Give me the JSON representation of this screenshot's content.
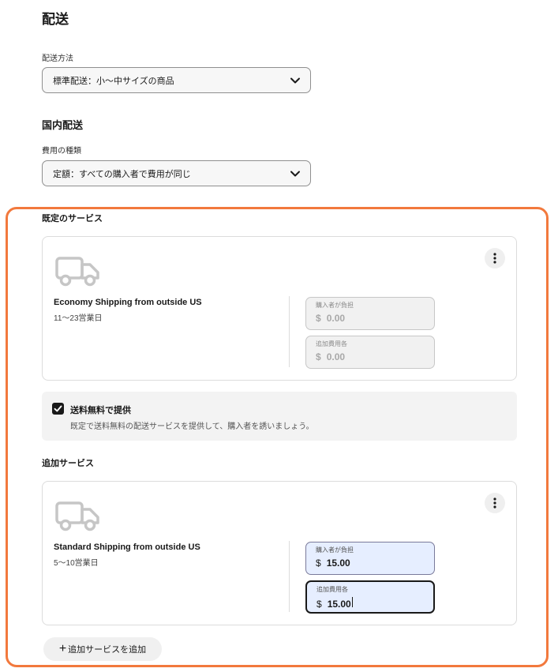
{
  "page": {
    "title": "配送"
  },
  "shipping_method": {
    "label": "配送方法",
    "value": "標準配送：小〜中サイズの商品"
  },
  "domestic": {
    "title": "国内配送",
    "cost_type_label": "費用の種類",
    "cost_type_value": "定額：すべての購入者で費用が同じ"
  },
  "default_services": {
    "title": "既定のサービス",
    "service": {
      "name": "Economy Shipping from outside US",
      "days": "11〜23営業日",
      "buyer_pays": {
        "label": "購入者が負担",
        "currency": "$",
        "value": "0.00"
      },
      "each_additional": {
        "label": "追加費用各",
        "currency": "$",
        "value": "0.00"
      }
    }
  },
  "free_shipping": {
    "checked": true,
    "label": "送料無料で提供",
    "description": "既定で送料無料の配送サービスを提供して、購入者を誘いましょう。"
  },
  "additional_services": {
    "title": "追加サービス",
    "service": {
      "name": "Standard Shipping from outside US",
      "days": "5〜10営業日",
      "buyer_pays": {
        "label": "購入者が負担",
        "currency": "$",
        "value": "15.00"
      },
      "each_additional": {
        "label": "追加費用各",
        "currency": "$",
        "value": "15.00"
      }
    },
    "add_button": {
      "plus": "+",
      "label": "追加サービスを追加"
    }
  },
  "icons": {
    "dropdown": "chevron-down-icon",
    "truck": "truck-icon",
    "more": "more-vertical-icon",
    "checkbox": "checkmark-icon"
  },
  "colors": {
    "highlight": "#f2793d",
    "focused_input_bg": "#e6eeff",
    "text": "#191919"
  }
}
